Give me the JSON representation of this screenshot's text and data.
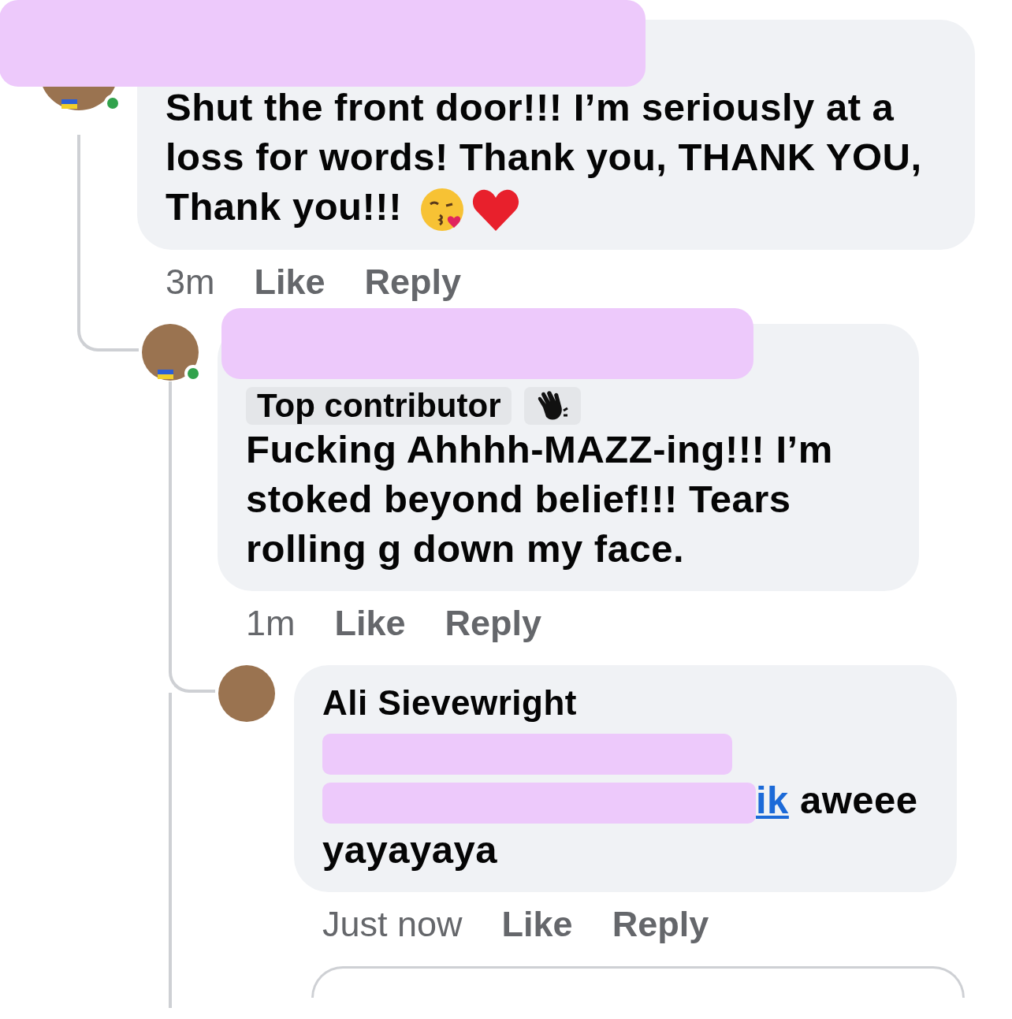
{
  "comments": [
    {
      "kind": "emoji_ending",
      "name_redacted": true,
      "online": true,
      "flag": true,
      "text": "Shut the front door!!! I’m seriously at a loss for words! Thank you, THANK YOU, Thank you!!!",
      "time": "3m",
      "actions": [
        "Like",
        "Reply"
      ],
      "children": [
        {
          "name_redacted": true,
          "online": true,
          "flag": true,
          "badges": [
            {
              "kind": "label",
              "label": "Top contributor"
            },
            {
              "kind": "wave"
            }
          ],
          "text": "Fucking Ahhhh-MAZZ-ing!!! I’m stoked beyond belief!!! Tears rolling g down my face.",
          "time": "1m",
          "actions": [
            "Like",
            "Reply"
          ],
          "children": [
            {
              "name": "Ali Sievewright",
              "badges_redacted": true,
              "mention": {
                "text": "ik",
                "redacted": true
              },
              "text": "aweee yayayaya",
              "time": "Just now",
              "actions": [
                "Like",
                "Reply"
              ]
            }
          ]
        }
      ]
    }
  ]
}
